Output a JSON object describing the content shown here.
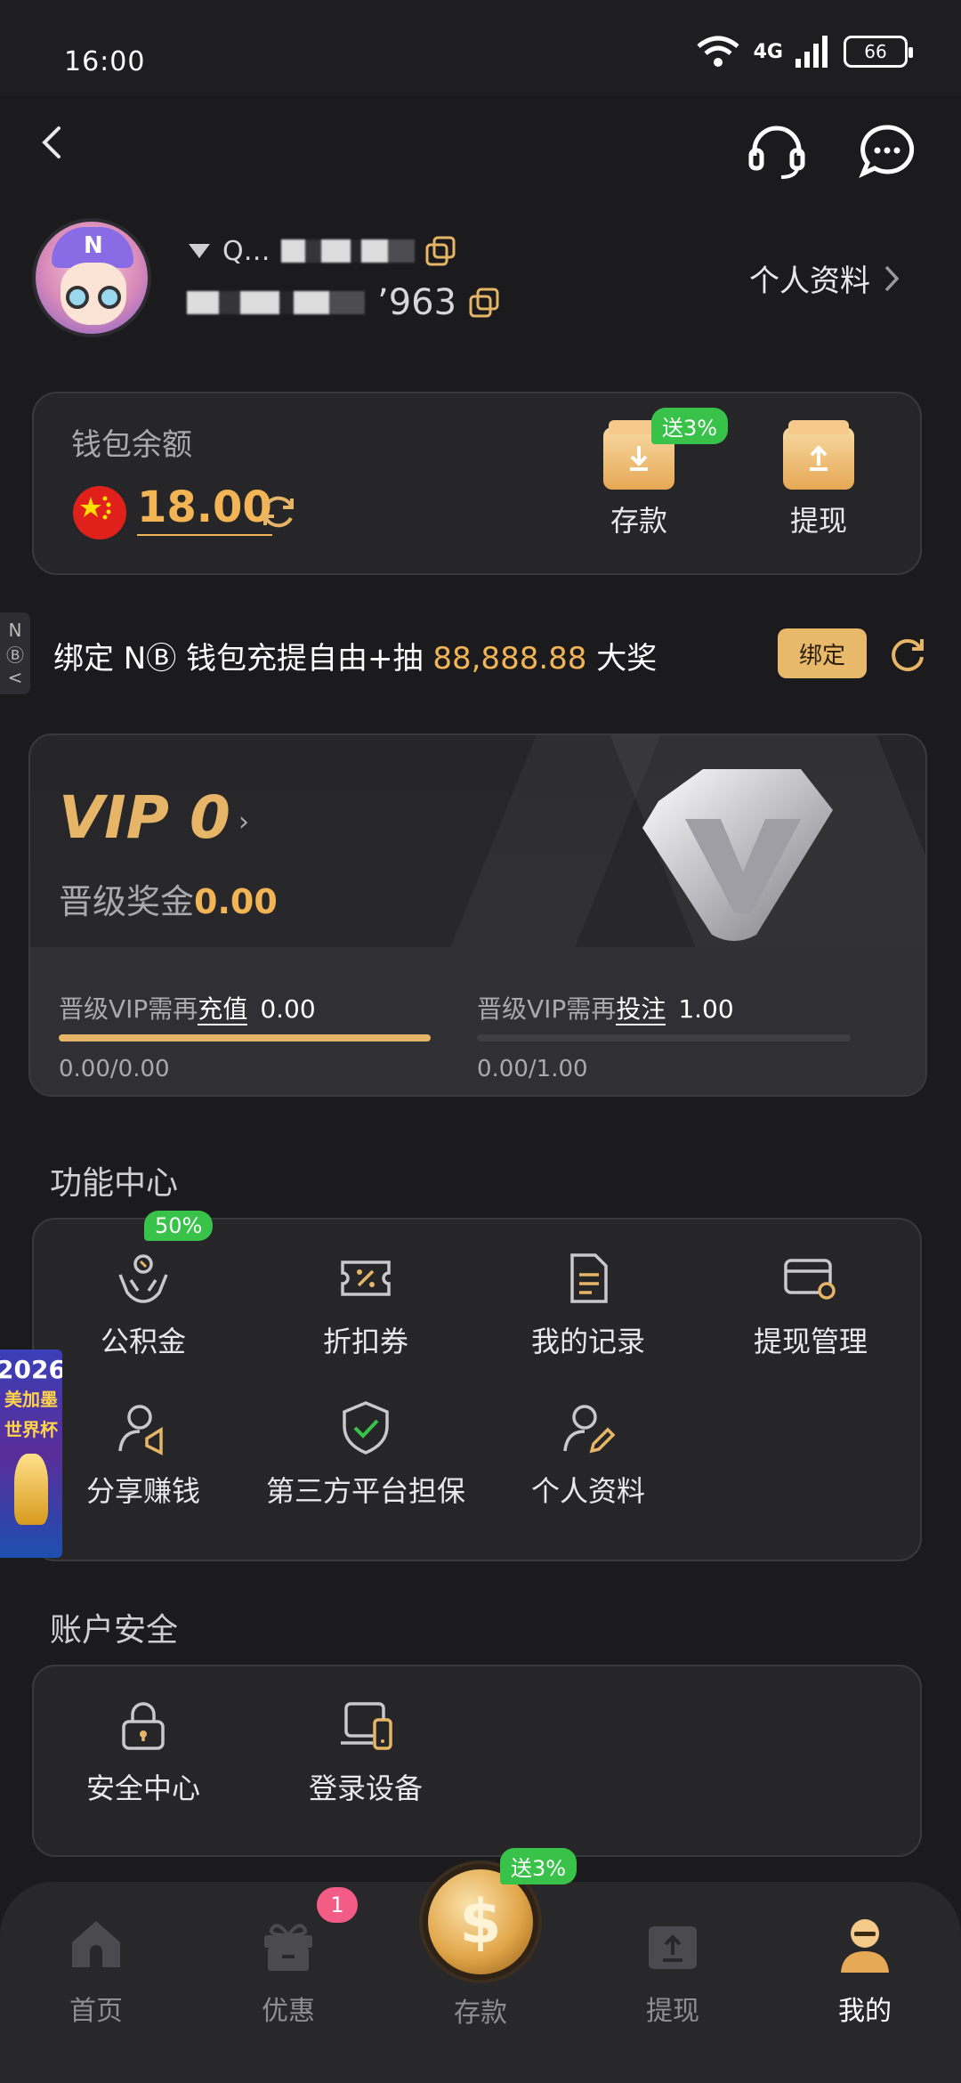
{
  "status_bar": {
    "time": "16:00",
    "signal_label": "4G",
    "battery": "66"
  },
  "profile": {
    "name_masked": "Q…",
    "id_suffix": "’963",
    "profile_link": "个人资料"
  },
  "wallet": {
    "label": "钱包余额",
    "balance": "18.00",
    "deposit_label": "存款",
    "deposit_badge": "送3%",
    "withdraw_label": "提现"
  },
  "bind_banner": {
    "text_pre": "绑定 NⒷ 钱包充提自由+抽 ",
    "amount": "88,888.88",
    "text_post": " 大奖",
    "button": "绑定"
  },
  "vip": {
    "title": "VIP 0",
    "bonus_label": "晋级奖金",
    "bonus_value": "0.00",
    "recharge_prefix": "晋级VIP需再",
    "recharge_word": "充值",
    "recharge_value": "0.00",
    "recharge_progress": "0.00/0.00",
    "recharge_fraction": 1.0,
    "bet_prefix": "晋级VIP需再",
    "bet_word": "投注",
    "bet_value": "1.00",
    "bet_progress": "0.00/1.00",
    "bet_fraction": 0.0
  },
  "function_center": {
    "title": "功能中心",
    "badge": "50%",
    "items": [
      {
        "label": "公积金",
        "icon": "fund-hands-icon"
      },
      {
        "label": "折扣券",
        "icon": "coupon-icon"
      },
      {
        "label": "我的记录",
        "icon": "records-icon"
      },
      {
        "label": "提现管理",
        "icon": "withdraw-card-icon"
      },
      {
        "label": "分享赚钱",
        "icon": "share-user-icon"
      },
      {
        "label": "第三方平台担保",
        "icon": "shield-check-icon"
      },
      {
        "label": "个人资料",
        "icon": "user-edit-icon"
      }
    ]
  },
  "account_security": {
    "title": "账户安全",
    "items": [
      {
        "label": "安全中心",
        "icon": "lock-icon"
      },
      {
        "label": "登录设备",
        "icon": "devices-icon"
      }
    ]
  },
  "floating": {
    "year": "2026",
    "line1": "美加墨",
    "line2": "世界杯"
  },
  "bottom_nav": {
    "home": "首页",
    "promo": "优惠",
    "promo_badge": "1",
    "deposit": "存款",
    "deposit_badge": "送3%",
    "withdraw": "提现",
    "mine": "我的"
  },
  "colors": {
    "accent": "#f2b455",
    "green": "#39c24a",
    "background": "#1b1b1e"
  }
}
